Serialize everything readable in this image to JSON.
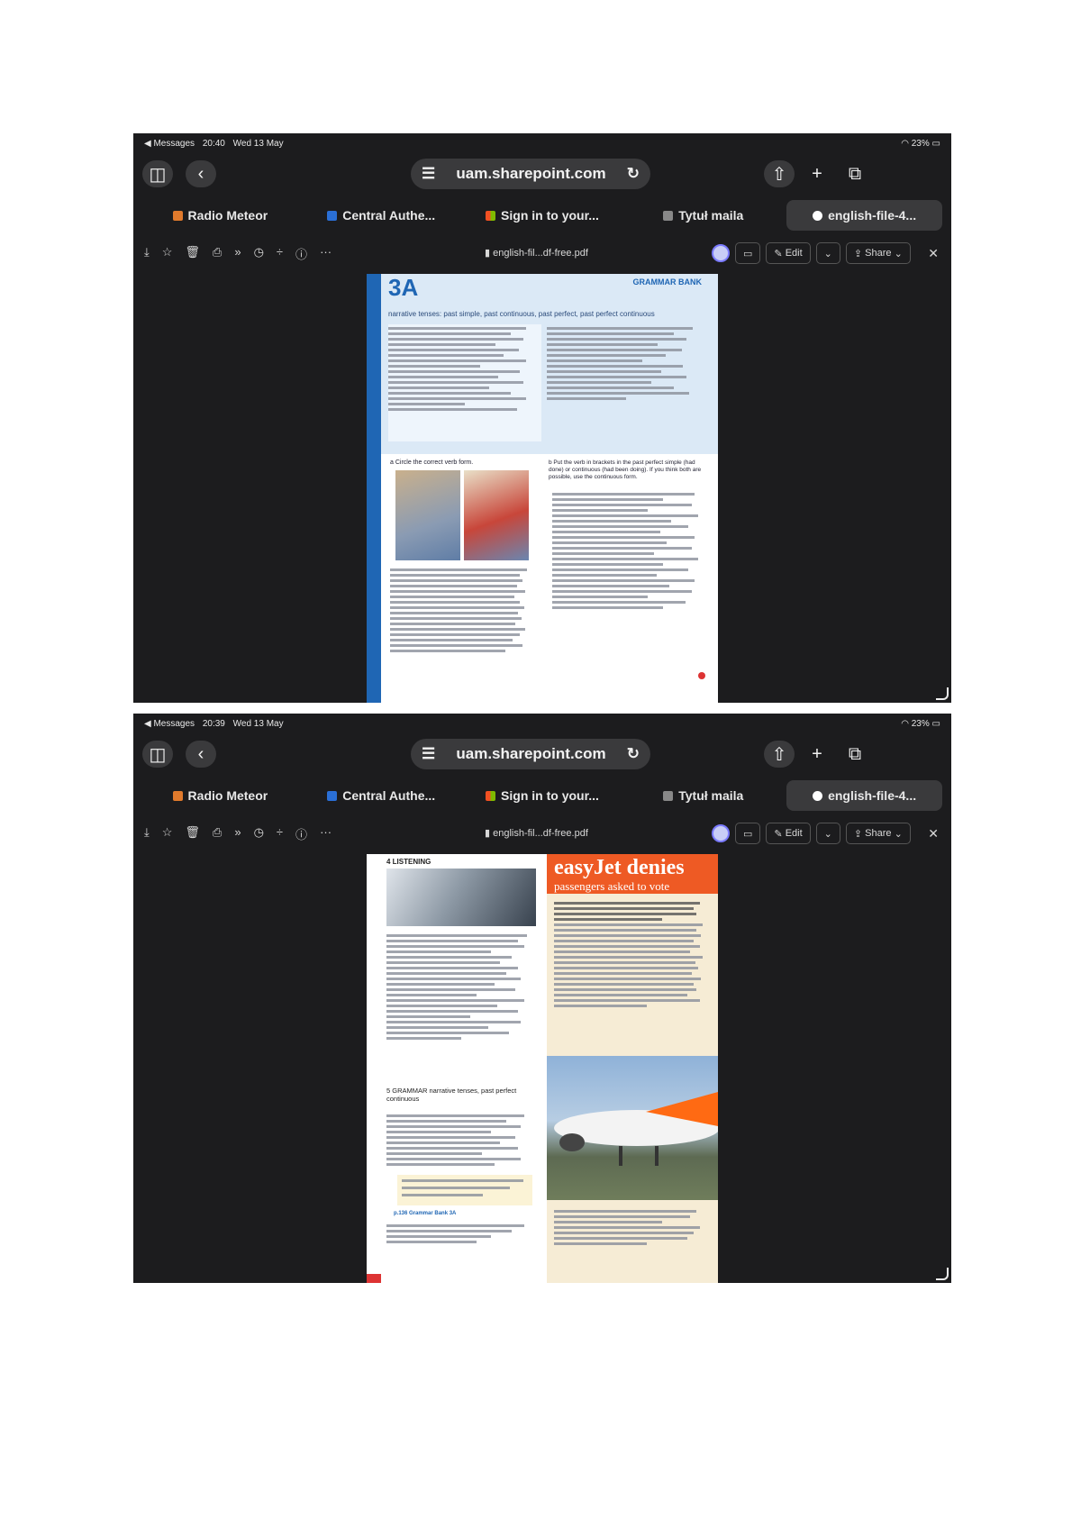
{
  "screens": [
    {
      "status": {
        "app": "◀ Messages",
        "time": "20:40",
        "date": "Wed 13 May",
        "battery": "23%"
      },
      "url": "uam.sharepoint.com",
      "tabs": [
        "Radio Meteor",
        "Central Authe...",
        "Sign in to your...",
        "Tytuł maila",
        "english-file-4..."
      ],
      "pdf": {
        "filename": "english-fil...df-free.pdf",
        "edit": "Edit",
        "share": "Share"
      },
      "page": {
        "unit": "3A",
        "bank": "GRAMMAR BANK",
        "heading": "narrative tenses: past simple, past continuous, past perfect, past perfect continuous",
        "section_a": "a  Circle the correct verb form.",
        "section_b": "b  Put the verb in brackets in the past perfect simple (had done) or continuous (had been doing). If you think both are possible, use the continuous form."
      }
    },
    {
      "status": {
        "app": "◀ Messages",
        "time": "20:39",
        "date": "Wed 13 May",
        "battery": "23%"
      },
      "url": "uam.sharepoint.com",
      "tabs": [
        "Radio Meteor",
        "Central Authe...",
        "Sign in to your...",
        "Tytuł maila",
        "english-file-4..."
      ],
      "pdf": {
        "filename": "english-fil...df-free.pdf",
        "edit": "Edit",
        "share": "Share"
      },
      "page": {
        "section4": "4  LISTENING",
        "headline": "easyJet denies",
        "subhead": "passengers asked to vote",
        "section5": "5  GRAMMAR  narrative tenses, past perfect continuous",
        "gb_link": "p.136 Grammar Bank 3A"
      }
    }
  ],
  "colors": {
    "accent_blue": "#1f66b4",
    "easyjet_orange": "#ff6a13",
    "page_bg_blue": "#cfe3f5"
  }
}
